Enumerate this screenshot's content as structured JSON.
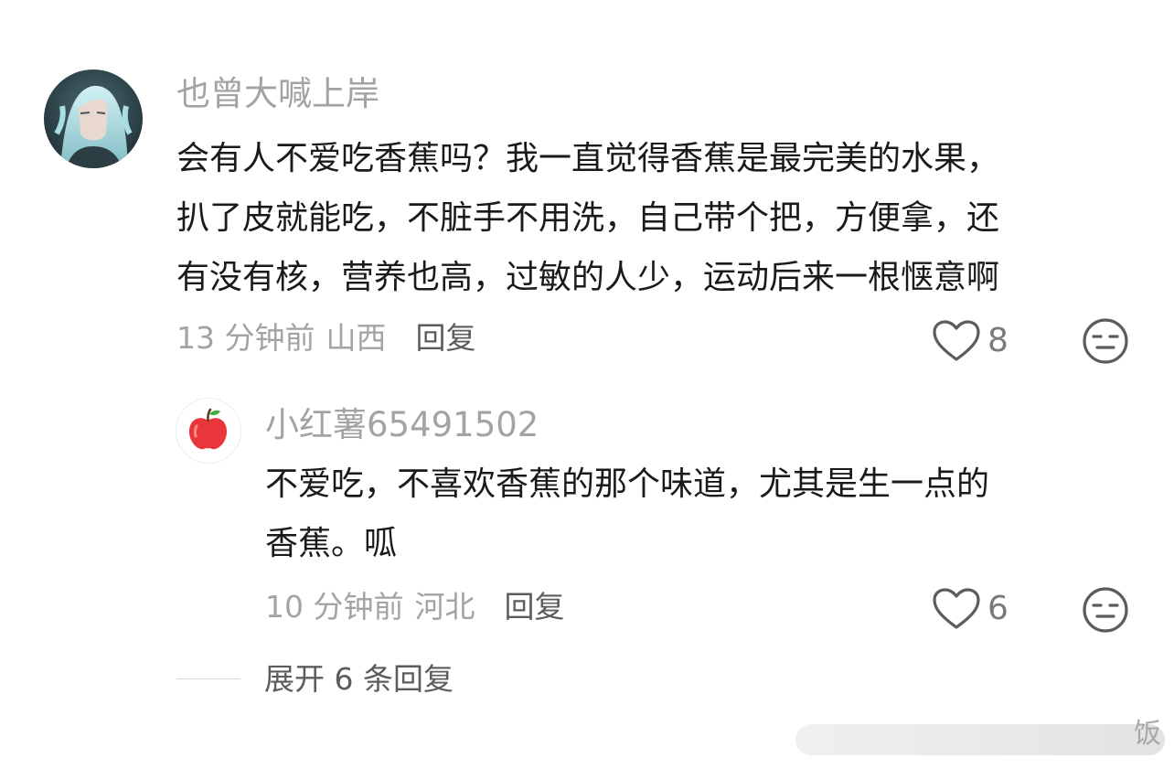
{
  "comment": {
    "username": "也曾大喊上岸",
    "text_lines": [
      "会有人不爱吃香蕉吗？我一直觉得香蕉是最完美的水果，",
      "扒了皮就能吃，不脏手不用洗，自己带个把，方便拿，还",
      "有没有核，营养也高，过敏的人少，运动后来一根惬意啊"
    ],
    "time": "13 分钟前",
    "location": "山西",
    "reply_label": "回复",
    "like_count": "8",
    "like_icon": "heart-outline-icon",
    "emoji_icon": "neutral-face-icon"
  },
  "reply": {
    "username": "小红薯65491502",
    "text_lines": [
      "不爱吃，不喜欢香蕉的那个味道，尤其是生一点的",
      "香蕉。呱"
    ],
    "time": "10 分钟前",
    "location": "河北",
    "reply_label": "回复",
    "like_count": "6",
    "like_icon": "heart-outline-icon",
    "emoji_icon": "neutral-face-icon",
    "avatar_icon": "apple-icon"
  },
  "expand": {
    "label": "展开 6 条回复"
  },
  "watermark": {
    "text": "饭"
  },
  "colors": {
    "text_primary": "#1a1a1a",
    "text_secondary": "#a3a3a3",
    "action": "#5c5c5c",
    "apple_red": "#e8363a",
    "avatar_hair": "#9fd6dc"
  }
}
